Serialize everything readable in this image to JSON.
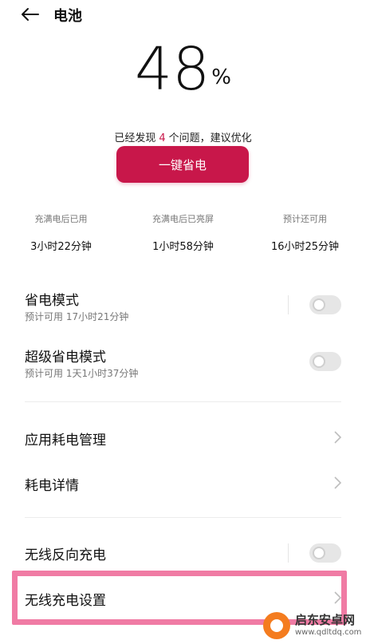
{
  "header": {
    "title": "电池"
  },
  "battery": {
    "percent": "48",
    "unit": "%"
  },
  "issues": {
    "prefix": "已经发现",
    "count": "4",
    "suffix": "个问题，建议优化"
  },
  "optimize_button": "一键省电",
  "stats": [
    {
      "label": "充满电后已用",
      "value": "3小时22分钟"
    },
    {
      "label": "充满电后已亮屏",
      "value": "1小时58分钟"
    },
    {
      "label": "预计还可用",
      "value": "16小时25分钟"
    }
  ],
  "settings": {
    "power_saving": {
      "label": "省电模式",
      "sub": "预计可用 17小时21分钟",
      "enabled": false
    },
    "super_power_saving": {
      "label": "超级省电模式",
      "sub": "预计可用 1天1小时37分钟",
      "enabled": false
    },
    "app_power": {
      "label": "应用耗电管理"
    },
    "power_details": {
      "label": "耗电详情"
    },
    "reverse_wireless": {
      "label": "无线反向充电",
      "enabled": false
    },
    "wireless_settings": {
      "label": "无线充电设置"
    }
  },
  "watermark": {
    "name": "启东安卓网",
    "url": "www.qdltdq.com"
  },
  "colors": {
    "accent": "#c8174a",
    "highlight": "#f07ba4"
  }
}
